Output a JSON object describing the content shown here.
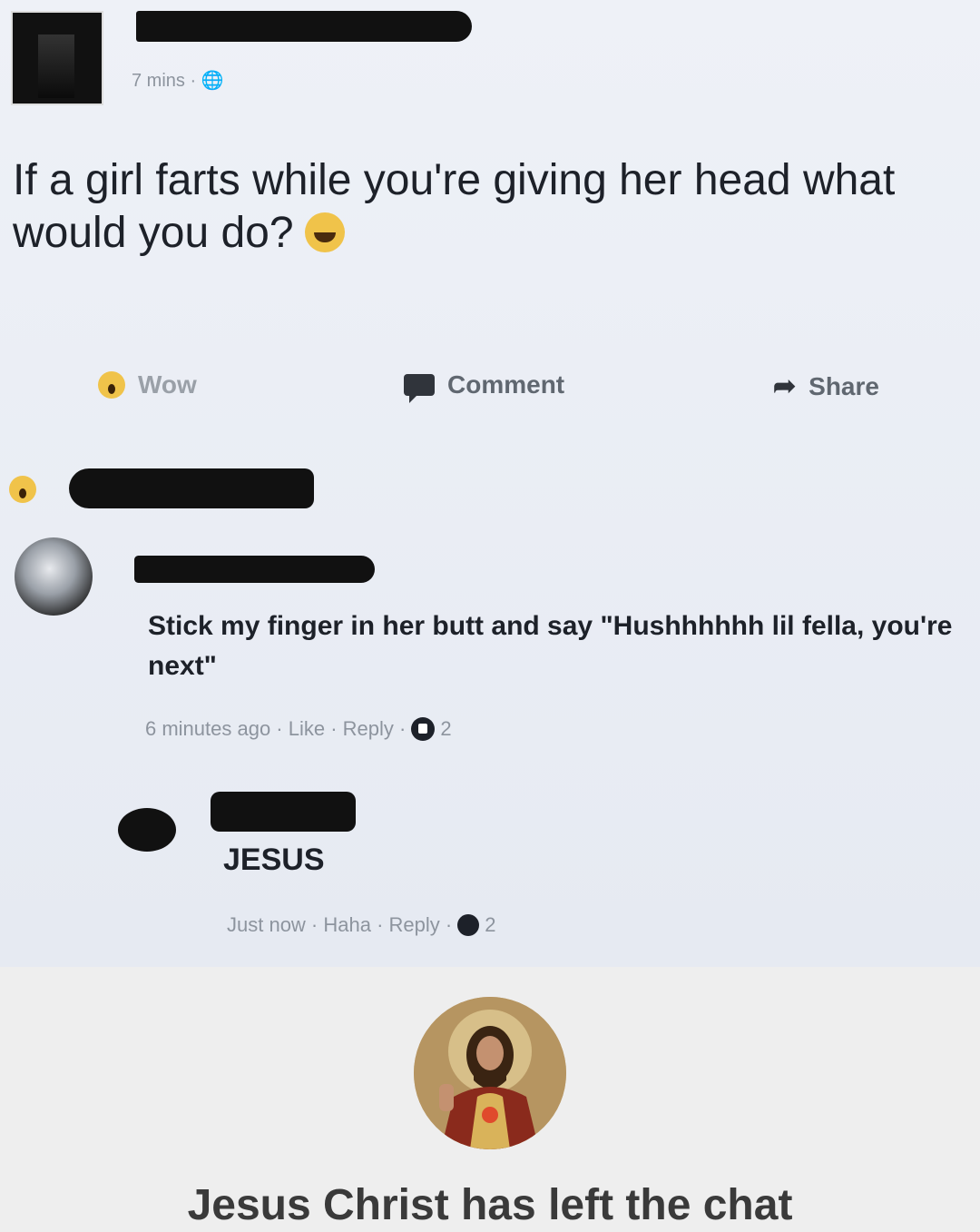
{
  "post": {
    "timestamp": "7 mins · 🌐",
    "text": "If a girl farts while you're giving her head what would you do?",
    "emoji_icon": "laughing-emoji"
  },
  "actions": {
    "wow_label": "Wow",
    "comment_label": "Comment",
    "share_label": "Share"
  },
  "comments": [
    {
      "text": "Stick my finger in her butt and say \"Hushhhhhh lil fella, you're next\"",
      "meta": "6 minutes ago · Like · Reply · ",
      "reaction_count": "2"
    },
    {
      "text": "JESUS",
      "meta": "Just now · Haha · Reply · ",
      "reaction_count": "2"
    }
  ],
  "caption": "Jesus Christ has left the chat",
  "colors": {
    "post_bg": "#edf0f6",
    "caption_bg": "#eeeeee",
    "text": "#1d2129",
    "meta": "#8d949e"
  }
}
